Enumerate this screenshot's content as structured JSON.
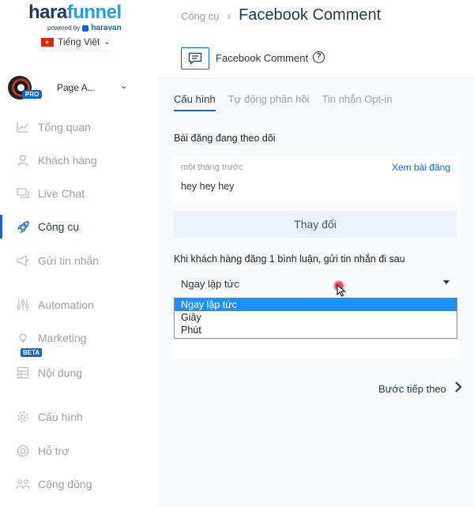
{
  "brand": {
    "name_a": "hara",
    "name_b": "funnel",
    "powered_by": "powered by",
    "partner": "haravan"
  },
  "language": {
    "label": "Tiếng Việt"
  },
  "page_selector": {
    "name": "Page A...",
    "badge": "PRO"
  },
  "sidebar": {
    "items": [
      {
        "label": "Tổng quan",
        "icon": "chart-line-icon"
      },
      {
        "label": "Khách hàng",
        "icon": "user-icon"
      },
      {
        "label": "Live Chat",
        "icon": "chat-bubble-icon"
      },
      {
        "label": "Công cụ",
        "icon": "rocket-icon",
        "active": true
      },
      {
        "label": "Gửi tin nhắn",
        "icon": "megaphone-icon"
      },
      {
        "label": "Automation",
        "icon": "sliders-icon"
      },
      {
        "label": "Marketing",
        "icon": "lightbulb-icon",
        "badge": "BETA"
      },
      {
        "label": "Nội dung",
        "icon": "content-icon"
      },
      {
        "label": "Cấu hình",
        "icon": "gear-icon"
      },
      {
        "label": "Hỗ trợ",
        "icon": "lifebuoy-icon"
      },
      {
        "label": "Cộng đồng",
        "icon": "users-icon"
      }
    ]
  },
  "breadcrumb": {
    "parent": "Công cụ",
    "separator": "›",
    "current": "Facebook Comment"
  },
  "header": {
    "title": "Facebook Comment"
  },
  "tabs": [
    {
      "label": "Cấu hình",
      "active": true
    },
    {
      "label": "Tự động phản hồi"
    },
    {
      "label": "Tin nhắn Opt-in"
    }
  ],
  "post": {
    "section_title": "Bài đăng đang theo dõi",
    "time": "một tháng trước",
    "link": "Xem bài đăng",
    "text": "hey hey hey"
  },
  "change_button": "Thay đổi",
  "delay": {
    "section_title": "Khi khách hàng đăng 1 bình luận, gửi tin nhắn đi sau",
    "selected": "Ngay lập tức",
    "options": [
      "Ngay lập tức",
      "Giây",
      "Phút"
    ]
  },
  "next_button": "Bước tiếp theo",
  "colors": {
    "primary": "#1565c0",
    "brand_dark": "#1f3b57",
    "muted": "#9aa1a9",
    "select_highlight": "#1e90ff"
  }
}
